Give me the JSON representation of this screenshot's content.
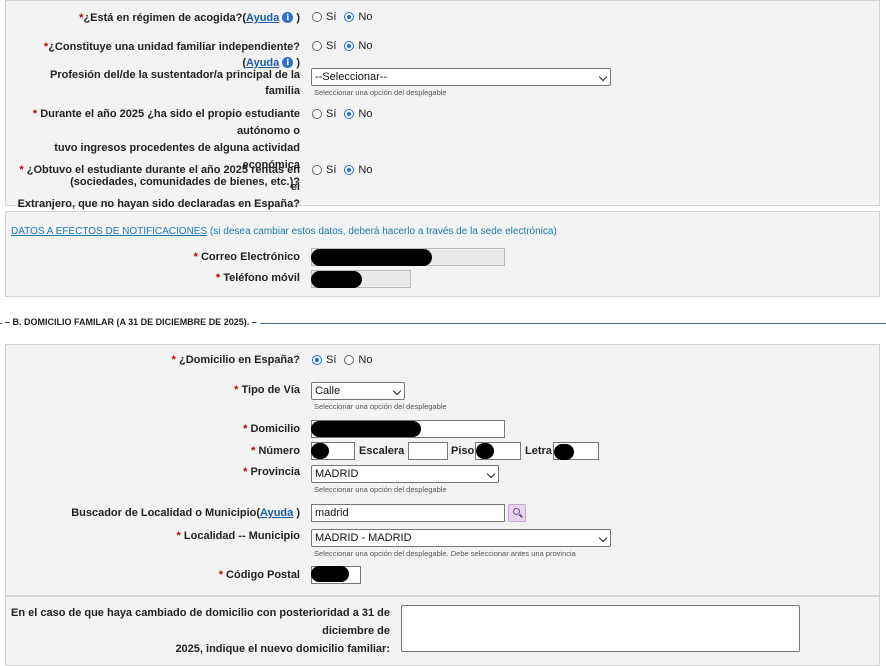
{
  "q1": {
    "label": "¿Está en régimen de acogida?(",
    "help": "Ayuda",
    "close": ")",
    "yes": "Sí",
    "no": "No",
    "selected": "No"
  },
  "q2": {
    "label": "¿Constituye una unidad familiar independiente?(",
    "help": "Ayuda",
    "close": ")",
    "yes": "Sí",
    "no": "No",
    "selected": "No"
  },
  "q3": {
    "label": "Profesión del/de la sustentador/a principal de la familia",
    "value": "--Seleccionar--",
    "hint": "Seleccionar una opción del desplegable"
  },
  "q4": {
    "line1": "Durante el año 2025 ¿ha sido el propio estudiante autónomo o",
    "line2": "tuvo ingresos procedentes de alguna actividad económica",
    "line3": "(sociedades, comunidades de bienes, etc.)?",
    "yes": "Sí",
    "no": "No",
    "selected": "No"
  },
  "q5": {
    "line1": "¿Obtuvo el estudiante durante el año 2025 rentas en el",
    "line2": "Extranjero, que no hayan sido declaradas en España?",
    "yes": "Sí",
    "no": "No",
    "selected": "No"
  },
  "notif": {
    "link": "DATOS A EFECTOS DE NOTIFICACIONES",
    "note": " (si desea cambiar estos datos, deberá hacerlo a través de la sede electrónica)",
    "email_label": "Correo Electrónico",
    "phone_label": "Teléfono móvil"
  },
  "sectionB": {
    "legend": "B. DOMICILIO FAMILAR (A 31 DE DICIEMBRE DE 2025)."
  },
  "dom": {
    "spain_label": "¿Domicilio en España?",
    "yes": "Sí",
    "no": "No",
    "selected": "Sí",
    "via_label": "Tipo de Vía",
    "via_value": "Calle",
    "via_hint": "Seleccionar una opción del desplegable",
    "domicilio_label": "Domicilio",
    "numero_label": "Número",
    "escalera_label": "Escalera",
    "piso_label": "Piso",
    "letra_label": "Letra",
    "provincia_label": "Provincia",
    "provincia_value": "MADRID",
    "provincia_hint": "Seleccionar una opción del desplegable",
    "buscador_label": "Buscador de Localidad o Municipio(",
    "buscador_help": "Ayuda",
    "buscador_close": ")",
    "buscador_value": "madrid",
    "localidad_label": "Localidad -- Municipio",
    "localidad_value": "MADRID - MADRID",
    "localidad_hint": "Seleccionar una opción del desplegable. Debe seleccionar antes una provincia",
    "cp_label": "Código Postal"
  },
  "change": {
    "line1": "En el caso de que haya cambiado de domicilio con posterioridad a 31 de diciembre de",
    "line2": "2025, indique el nuevo domicilio familiar:"
  },
  "required_mark": "*",
  "colors": {
    "panel": "#f3f3f3",
    "link": "#1a5ea8",
    "required": "#c00000",
    "radio": "#1a6fd6"
  }
}
